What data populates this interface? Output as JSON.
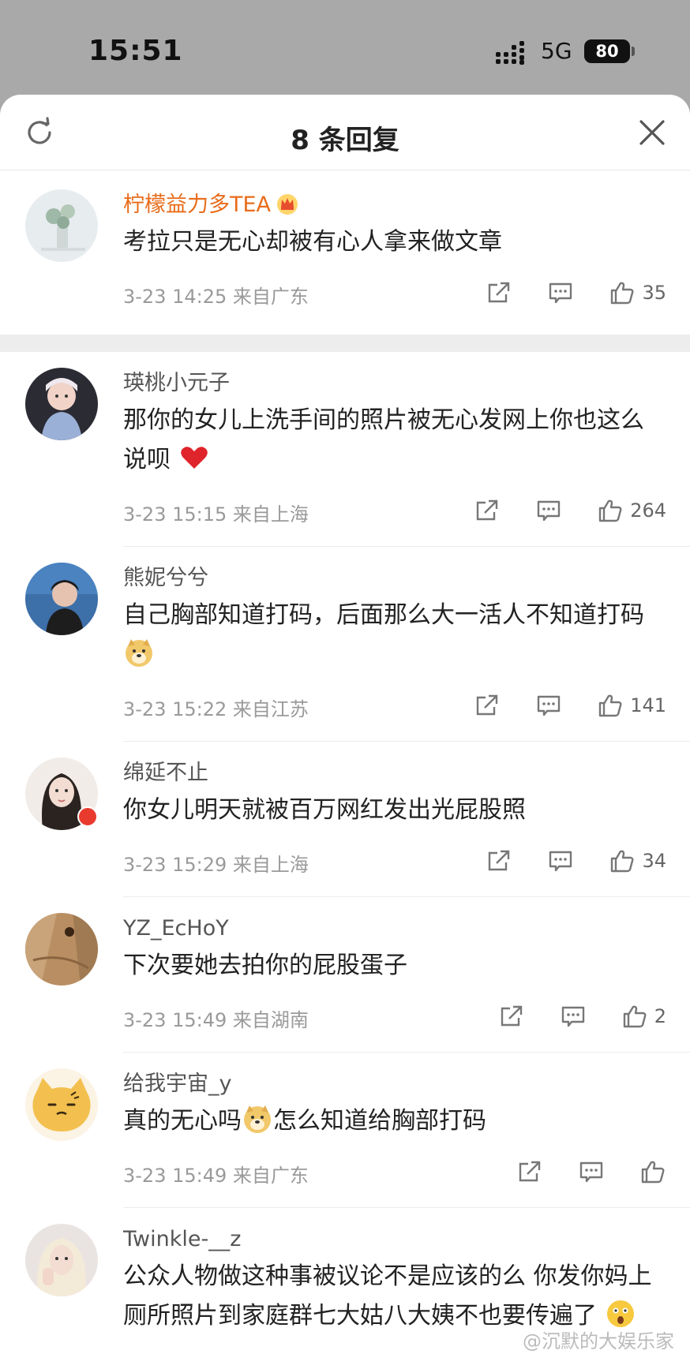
{
  "status": {
    "time": "15:51",
    "network": "5G",
    "battery": "80"
  },
  "header": {
    "title": "8 条回复"
  },
  "watermark": "@沉默的大娱乐家",
  "comments": [
    {
      "user": "柠檬益力多TEA",
      "text": "考拉只是无心却被有心人拿来做文章",
      "meta": "3-23 14:25 来自广东",
      "likes": "35"
    },
    {
      "user": "瑛桃小元子",
      "text": "那你的女儿上洗手间的照片被无心发网上你也这么说呗",
      "meta": "3-23 15:15 来自上海",
      "likes": "264"
    },
    {
      "user": "熊妮兮兮",
      "text": "自己胸部知道打码，后面那么大一活人不知道打码",
      "meta": "3-23 15:22 来自江苏",
      "likes": "141"
    },
    {
      "user": "绵延不止",
      "text": "你女儿明天就被百万网红发出光屁股照",
      "meta": "3-23 15:29 来自上海",
      "likes": "34"
    },
    {
      "user": "YZ_EcHoY",
      "text": "下次要她去拍你的屁股蛋子",
      "meta": "3-23 15:49 来自湖南",
      "likes": "2"
    },
    {
      "user": "给我宇宙_y",
      "text_a": "真的无心吗",
      "text_b": "怎么知道给胸部打码",
      "meta": "3-23 15:49 来自广东",
      "likes": ""
    },
    {
      "user": "Twinkle-__z",
      "text": "公众人物做这种事被议论不是应该的么 你发你妈上厕所照片到家庭群七大姑八大姨不也要传遍了",
      "meta": "",
      "likes": ""
    }
  ],
  "icons": {
    "share": "share-icon",
    "comment": "comment-icon",
    "like": "thumbs-up-icon",
    "heart": "red-heart-emoji",
    "doge": "doge-emoji",
    "shocked": "shocked-emoji"
  },
  "colors": {
    "vip_name": "#e86c1a",
    "meta": "#9a9a9a",
    "badge": "#e93a2e"
  }
}
